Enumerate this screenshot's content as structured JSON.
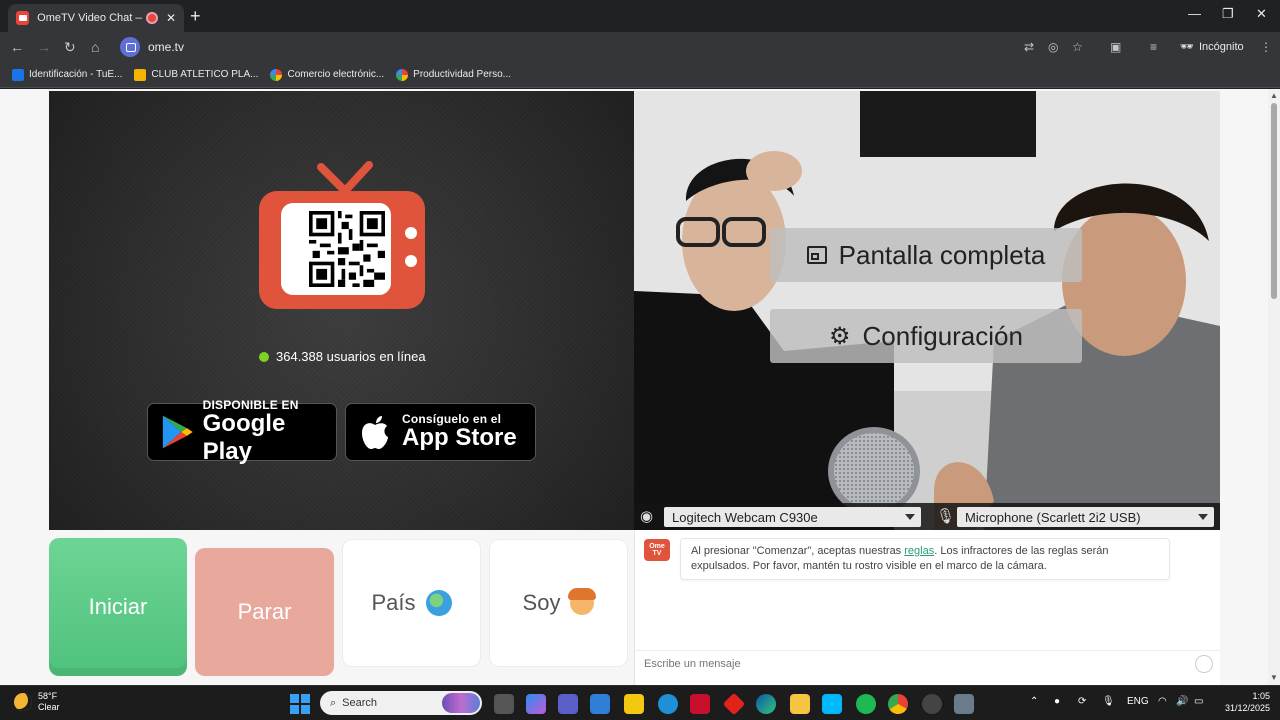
{
  "browser": {
    "tab_title": "OmeTV Video Chat — Ome",
    "url": "ome.tv",
    "incognito_label": "Incógnito",
    "bookmarks": [
      {
        "label": "Identificación - TuE...",
        "icon": "site-icon"
      },
      {
        "label": "CLUB ATLETICO PLA...",
        "icon": "club-crest-icon"
      },
      {
        "label": "Comercio electrónic...",
        "icon": "google-icon"
      },
      {
        "label": "Productividad Perso...",
        "icon": "google-icon"
      }
    ]
  },
  "page": {
    "online_count": "364.388 usuarios en línea",
    "google_play": {
      "small": "DISPONIBLE EN",
      "big": "Google Play"
    },
    "app_store": {
      "small": "Consíguelo en el",
      "big": "App Store"
    },
    "overlay": {
      "fullscreen": "Pantalla completa",
      "settings": "Configuración"
    },
    "devices": {
      "camera": "Logitech Webcam C930e",
      "microphone": "Microphone (Scarlett 2i2 USB)"
    },
    "controls": {
      "start": "Iniciar",
      "stop": "Parar",
      "country": "País",
      "gender": "Soy"
    },
    "chat": {
      "logo_text": "Ome TV",
      "message_before": "Al presionar \"Comenzar\", aceptas nuestras ",
      "rules_link": "reglas",
      "message_after": ". Los infractores de las reglas serán expulsados. Por favor, mantén tu rostro visible en el marco de la cámara.",
      "input_placeholder": "Escribe un mensaje"
    },
    "colors": {
      "start": "#4fc27c",
      "stop": "#e8a99c",
      "brand": "#e0543c",
      "online": "#7ed321"
    }
  },
  "taskbar": {
    "weather_temp": "58°F",
    "weather_desc": "Clear",
    "search_placeholder": "Search",
    "language": "ENG",
    "time": "1:05",
    "date": "31/12/2025"
  }
}
